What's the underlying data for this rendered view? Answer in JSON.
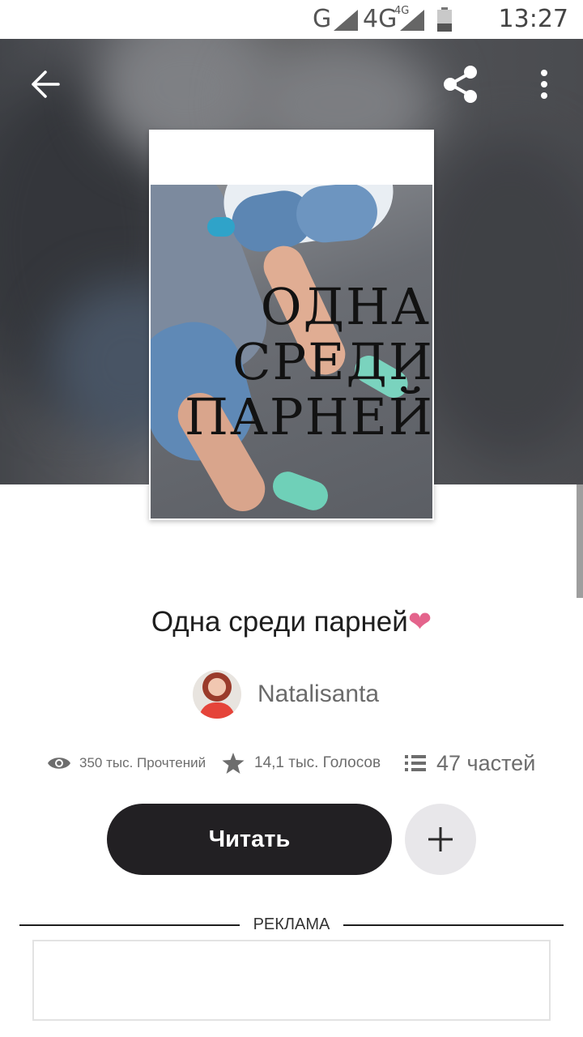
{
  "status_bar": {
    "network_primary": "G",
    "network_secondary": "4G",
    "network_secondary_super": "4G",
    "time": "13:27"
  },
  "toolbar": {
    "back_icon": "arrow-left-icon",
    "share_icon": "share-icon",
    "more_icon": "more-vertical-icon"
  },
  "cover": {
    "title_lines": [
      "ОДНА",
      "СРЕДИ",
      "ПАРНЕЙ"
    ]
  },
  "story": {
    "title": "Одна среди парней",
    "title_emoji": "❤",
    "author": "Natalisanta"
  },
  "stats": {
    "reads": "350 тыс. Прочтений",
    "votes": "14,1 тыс. Голосов",
    "parts": "47 частей"
  },
  "actions": {
    "read_label": "Читать",
    "add_icon": "plus-icon"
  },
  "ad": {
    "label": "РЕКЛАМА"
  },
  "colors": {
    "accent_dark": "#222023",
    "heart": "#e4648c",
    "secondary_text": "#6d6d6d"
  }
}
